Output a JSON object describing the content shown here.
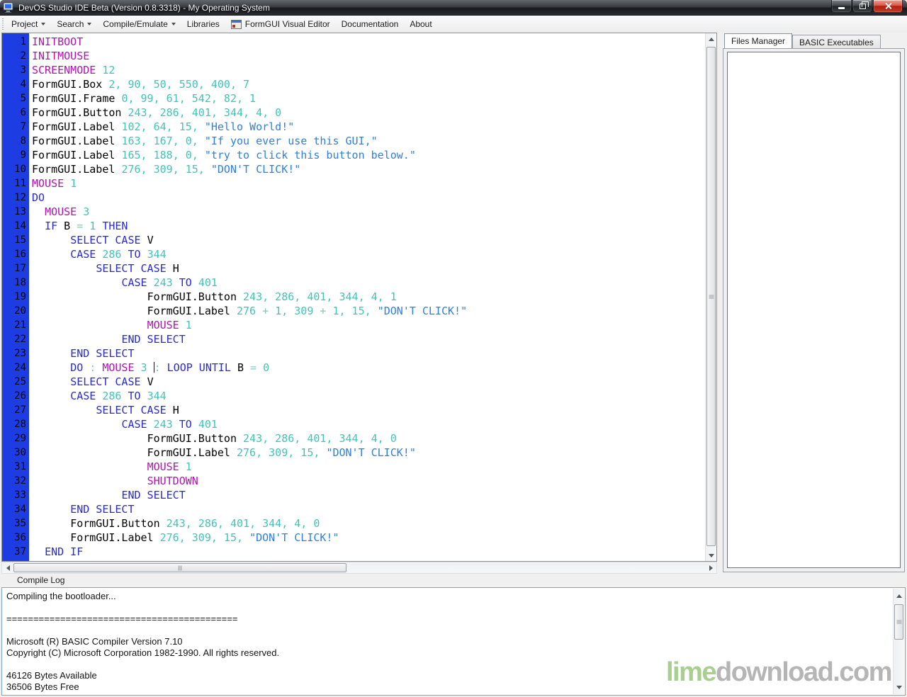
{
  "window": {
    "title": "DevOS Studio IDE Beta (Version 0.8.3318) - My Operating System"
  },
  "menu": {
    "items": [
      {
        "label": "Project",
        "dropdown": true
      },
      {
        "label": "Search",
        "dropdown": true
      },
      {
        "label": "Compile/Emulate",
        "dropdown": true
      },
      {
        "label": "Libraries",
        "dropdown": false
      },
      {
        "label": "FormGUI Visual Editor",
        "dropdown": false,
        "icon": "form-window-icon"
      },
      {
        "label": "Documentation",
        "dropdown": false
      },
      {
        "label": "About",
        "dropdown": false
      }
    ]
  },
  "editor": {
    "lines": [
      {
        "n": 1,
        "t": [
          [
            "c",
            "INITBOOT"
          ]
        ]
      },
      {
        "n": 2,
        "t": [
          [
            "c",
            "INITMOUSE"
          ]
        ]
      },
      {
        "n": 3,
        "t": [
          [
            "c",
            "SCREENMODE"
          ],
          [
            "t",
            " "
          ],
          [
            "n",
            "12"
          ]
        ]
      },
      {
        "n": 4,
        "t": [
          [
            "i",
            "FormGUI.Box"
          ],
          [
            "t",
            " "
          ],
          [
            "n",
            "2, 90, 50, 550, 400, 7"
          ]
        ]
      },
      {
        "n": 5,
        "t": [
          [
            "i",
            "FormGUI.Frame"
          ],
          [
            "t",
            " "
          ],
          [
            "n",
            "0, 99, 61, 542, 82, 1"
          ]
        ]
      },
      {
        "n": 6,
        "t": [
          [
            "i",
            "FormGUI.Button"
          ],
          [
            "t",
            " "
          ],
          [
            "n",
            "243, 286, 401, 344, 4, 0"
          ]
        ]
      },
      {
        "n": 7,
        "t": [
          [
            "i",
            "FormGUI.Label"
          ],
          [
            "t",
            " "
          ],
          [
            "n",
            "102, 64, 15,"
          ],
          [
            "t",
            " "
          ],
          [
            "s",
            "\"Hello World!\""
          ]
        ]
      },
      {
        "n": 8,
        "t": [
          [
            "i",
            "FormGUI.Label"
          ],
          [
            "t",
            " "
          ],
          [
            "n",
            "163, 167, 0,"
          ],
          [
            "t",
            " "
          ],
          [
            "s",
            "\"If you ever use this GUI,\""
          ]
        ]
      },
      {
        "n": 9,
        "t": [
          [
            "i",
            "FormGUI.Label"
          ],
          [
            "t",
            " "
          ],
          [
            "n",
            "165, 188, 0,"
          ],
          [
            "t",
            " "
          ],
          [
            "s",
            "\"try to click this button below.\""
          ]
        ]
      },
      {
        "n": 10,
        "t": [
          [
            "i",
            "FormGUI.Label"
          ],
          [
            "t",
            " "
          ],
          [
            "n",
            "276, 309, 15,"
          ],
          [
            "t",
            " "
          ],
          [
            "s",
            "\"DON'T CLICK!\""
          ]
        ]
      },
      {
        "n": 11,
        "t": [
          [
            "c",
            "MOUSE"
          ],
          [
            "t",
            " "
          ],
          [
            "n",
            "1"
          ]
        ]
      },
      {
        "n": 12,
        "t": [
          [
            "k",
            "DO"
          ]
        ]
      },
      {
        "n": 13,
        "t": [
          [
            "t",
            "  "
          ],
          [
            "c",
            "MOUSE"
          ],
          [
            "t",
            " "
          ],
          [
            "n",
            "3"
          ]
        ]
      },
      {
        "n": 14,
        "t": [
          [
            "t",
            "  "
          ],
          [
            "k",
            "IF"
          ],
          [
            "t",
            " "
          ],
          [
            "i",
            "B"
          ],
          [
            "o",
            " = "
          ],
          [
            "n",
            "1"
          ],
          [
            "t",
            " "
          ],
          [
            "k",
            "THEN"
          ]
        ]
      },
      {
        "n": 15,
        "t": [
          [
            "t",
            "      "
          ],
          [
            "k",
            "SELECT CASE"
          ],
          [
            "t",
            " "
          ],
          [
            "i",
            "V"
          ]
        ]
      },
      {
        "n": 16,
        "t": [
          [
            "t",
            "      "
          ],
          [
            "k",
            "CASE"
          ],
          [
            "t",
            " "
          ],
          [
            "n",
            "286"
          ],
          [
            "t",
            " "
          ],
          [
            "k",
            "TO"
          ],
          [
            "t",
            " "
          ],
          [
            "n",
            "344"
          ]
        ]
      },
      {
        "n": 17,
        "t": [
          [
            "t",
            "          "
          ],
          [
            "k",
            "SELECT CASE"
          ],
          [
            "t",
            " "
          ],
          [
            "i",
            "H"
          ]
        ]
      },
      {
        "n": 18,
        "t": [
          [
            "t",
            "              "
          ],
          [
            "k",
            "CASE"
          ],
          [
            "t",
            " "
          ],
          [
            "n",
            "243"
          ],
          [
            "t",
            " "
          ],
          [
            "k",
            "TO"
          ],
          [
            "t",
            " "
          ],
          [
            "n",
            "401"
          ]
        ]
      },
      {
        "n": 19,
        "t": [
          [
            "t",
            "                  "
          ],
          [
            "i",
            "FormGUI.Button"
          ],
          [
            "t",
            " "
          ],
          [
            "n",
            "243, 286, 401, 344, 4, 1"
          ]
        ]
      },
      {
        "n": 20,
        "t": [
          [
            "t",
            "                  "
          ],
          [
            "i",
            "FormGUI.Label"
          ],
          [
            "t",
            " "
          ],
          [
            "n",
            "276"
          ],
          [
            "o",
            " + "
          ],
          [
            "n",
            "1,"
          ],
          [
            "t",
            " "
          ],
          [
            "n",
            "309"
          ],
          [
            "o",
            " + "
          ],
          [
            "n",
            "1, 15,"
          ],
          [
            "t",
            " "
          ],
          [
            "s",
            "\"DON'T CLICK!\""
          ]
        ]
      },
      {
        "n": 21,
        "t": [
          [
            "t",
            "                  "
          ],
          [
            "c",
            "MOUSE"
          ],
          [
            "t",
            " "
          ],
          [
            "n",
            "1"
          ]
        ]
      },
      {
        "n": 22,
        "t": [
          [
            "t",
            "              "
          ],
          [
            "k",
            "END SELECT"
          ]
        ]
      },
      {
        "n": 23,
        "t": [
          [
            "t",
            "      "
          ],
          [
            "k",
            "END SELECT"
          ]
        ]
      },
      {
        "n": 24,
        "t": [
          [
            "t",
            "      "
          ],
          [
            "k",
            "DO"
          ],
          [
            "o",
            " : "
          ],
          [
            "c",
            "MOUSE"
          ],
          [
            "t",
            " "
          ],
          [
            "n",
            "3"
          ],
          [
            "t",
            " "
          ],
          [
            "caret",
            ""
          ],
          [
            "o",
            ": "
          ],
          [
            "k",
            "LOOP UNTIL"
          ],
          [
            "t",
            " "
          ],
          [
            "i",
            "B"
          ],
          [
            "o",
            " = "
          ],
          [
            "n",
            "0"
          ]
        ]
      },
      {
        "n": 25,
        "t": [
          [
            "t",
            "      "
          ],
          [
            "k",
            "SELECT CASE"
          ],
          [
            "t",
            " "
          ],
          [
            "i",
            "V"
          ]
        ]
      },
      {
        "n": 26,
        "t": [
          [
            "t",
            "      "
          ],
          [
            "k",
            "CASE"
          ],
          [
            "t",
            " "
          ],
          [
            "n",
            "286"
          ],
          [
            "t",
            " "
          ],
          [
            "k",
            "TO"
          ],
          [
            "t",
            " "
          ],
          [
            "n",
            "344"
          ]
        ]
      },
      {
        "n": 27,
        "t": [
          [
            "t",
            "          "
          ],
          [
            "k",
            "SELECT CASE"
          ],
          [
            "t",
            " "
          ],
          [
            "i",
            "H"
          ]
        ]
      },
      {
        "n": 28,
        "t": [
          [
            "t",
            "              "
          ],
          [
            "k",
            "CASE"
          ],
          [
            "t",
            " "
          ],
          [
            "n",
            "243"
          ],
          [
            "t",
            " "
          ],
          [
            "k",
            "TO"
          ],
          [
            "t",
            " "
          ],
          [
            "n",
            "401"
          ]
        ]
      },
      {
        "n": 29,
        "t": [
          [
            "t",
            "                  "
          ],
          [
            "i",
            "FormGUI.Button"
          ],
          [
            "t",
            " "
          ],
          [
            "n",
            "243, 286, 401, 344, 4, 0"
          ]
        ]
      },
      {
        "n": 30,
        "t": [
          [
            "t",
            "                  "
          ],
          [
            "i",
            "FormGUI.Label"
          ],
          [
            "t",
            " "
          ],
          [
            "n",
            "276, 309, 15,"
          ],
          [
            "t",
            " "
          ],
          [
            "s",
            "\"DON'T CLICK!\""
          ]
        ]
      },
      {
        "n": 31,
        "t": [
          [
            "t",
            "                  "
          ],
          [
            "c",
            "MOUSE"
          ],
          [
            "t",
            " "
          ],
          [
            "n",
            "1"
          ]
        ]
      },
      {
        "n": 32,
        "t": [
          [
            "t",
            "                  "
          ],
          [
            "c",
            "SHUTDOWN"
          ]
        ]
      },
      {
        "n": 33,
        "t": [
          [
            "t",
            "              "
          ],
          [
            "k",
            "END SELECT"
          ]
        ]
      },
      {
        "n": 34,
        "t": [
          [
            "t",
            "      "
          ],
          [
            "k",
            "END SELECT"
          ]
        ]
      },
      {
        "n": 35,
        "t": [
          [
            "t",
            "      "
          ],
          [
            "i",
            "FormGUI.Button"
          ],
          [
            "t",
            " "
          ],
          [
            "n",
            "243, 286, 401, 344, 4, 0"
          ]
        ]
      },
      {
        "n": 36,
        "t": [
          [
            "t",
            "      "
          ],
          [
            "i",
            "FormGUI.Label"
          ],
          [
            "t",
            " "
          ],
          [
            "n",
            "276, 309, 15,"
          ],
          [
            "t",
            " "
          ],
          [
            "s",
            "\"DON'T CLICK!\""
          ]
        ]
      },
      {
        "n": 37,
        "t": [
          [
            "t",
            "  "
          ],
          [
            "k",
            "END IF"
          ]
        ]
      }
    ]
  },
  "right_panel": {
    "tabs": [
      {
        "label": "Files Manager",
        "active": true
      },
      {
        "label": "BASIC Executables",
        "active": false
      }
    ]
  },
  "compile_log": {
    "label": "Compile Log",
    "lines": [
      "Compiling the bootloader...",
      "",
      "===========================================",
      "",
      "Microsoft (R) BASIC Compiler Version 7.10",
      "Copyright (C) Microsoft Corporation 1982-1990. All rights reserved.",
      "",
      "46126 Bytes Available",
      "36506 Bytes Free"
    ]
  },
  "watermark": {
    "lime": "lime",
    "rest": "download.com"
  },
  "colors": {
    "gutter": "#1d3ce2",
    "kw": "#2a2ad2",
    "cmd": "#b013b0",
    "num": "#40c4b8",
    "str": "#2e7fe1",
    "op": "#84c8bc",
    "id": "#000000",
    "log_border": "#7da7c9",
    "wm_lime": "#a8cf8e",
    "wm_gray": "#b5b5b5"
  }
}
